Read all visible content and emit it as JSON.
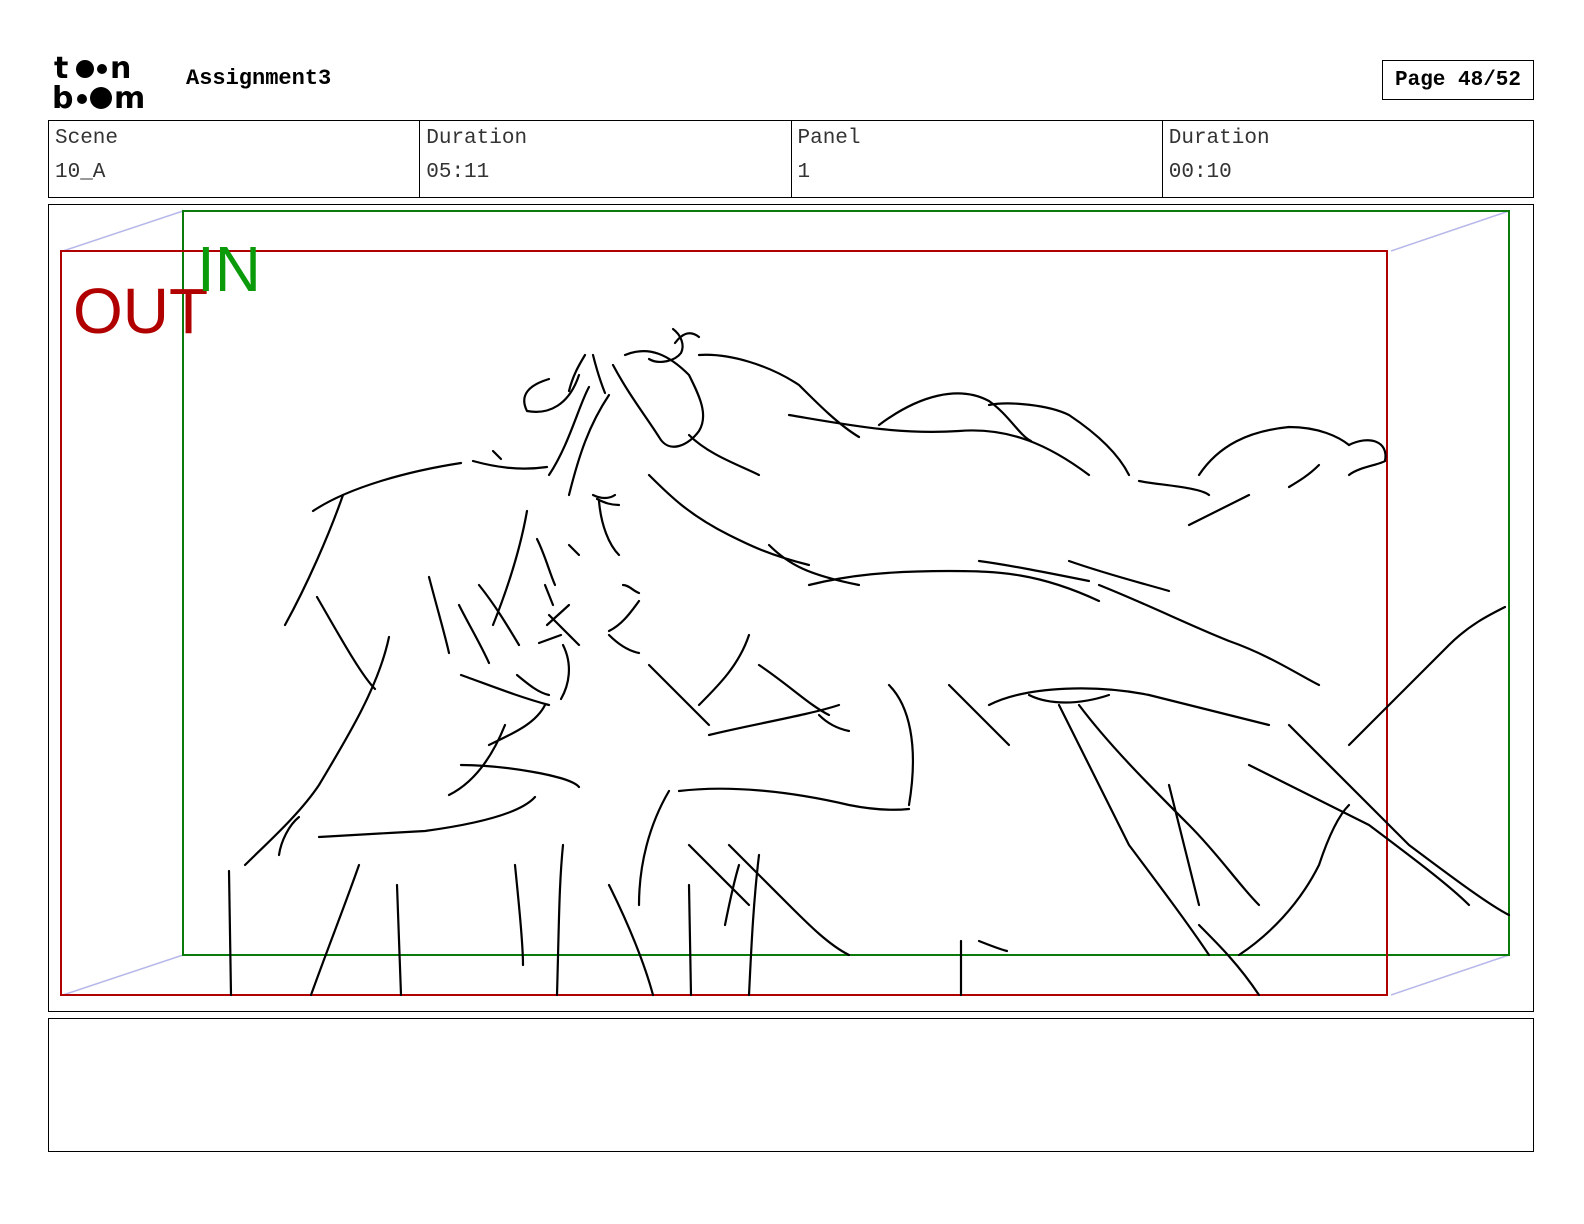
{
  "header": {
    "logo_text": "toon boom",
    "project_title": "Assignment3",
    "page_indicator": "Page 48/52"
  },
  "info": {
    "scene_label": "Scene",
    "scene_value": "10_A",
    "scene_duration_label": "Duration",
    "scene_duration_value": "05:11",
    "panel_label": "Panel",
    "panel_value": "1",
    "panel_duration_label": "Duration",
    "panel_duration_value": "00:10"
  },
  "panel": {
    "in_label": "IN",
    "out_label": "OUT",
    "in_color": "#008a00",
    "out_color": "#b00000"
  },
  "notes": {
    "text": ""
  }
}
